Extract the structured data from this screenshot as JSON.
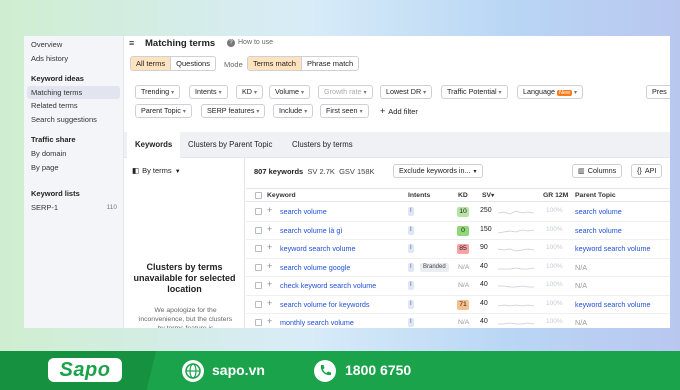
{
  "sidebar": {
    "overview": "Overview",
    "ads_history": "Ads history",
    "keyword_ideas_head": "Keyword ideas",
    "matching_terms": "Matching terms",
    "related_terms": "Related terms",
    "search_suggestions": "Search suggestions",
    "traffic_share_head": "Traffic share",
    "by_domain": "By domain",
    "by_page": "By page",
    "keyword_lists_head": "Keyword lists",
    "serp_list": "SERP-1",
    "serp_count": "110"
  },
  "header": {
    "menu_icon": "≡",
    "title": "Matching terms",
    "how_to_use": "How to use"
  },
  "scope": {
    "all_terms": "All terms",
    "questions": "Questions",
    "mode_label": "Mode",
    "terms_match": "Terms match",
    "phrase_match": "Phrase match"
  },
  "filters": {
    "trending": "Trending",
    "intents": "Intents",
    "kd": "KD",
    "volume": "Volume",
    "growth_rate": "Growth rate",
    "lowest_dr": "Lowest DR",
    "traffic_potential": "Traffic Potential",
    "language": "Language",
    "new_badge": "New",
    "pres": "Pres",
    "parent_topic": "Parent Topic",
    "serp_features": "SERP features",
    "include": "Include",
    "first_seen": "First seen",
    "add_filter": "Add filter"
  },
  "tabs": {
    "keywords": "Keywords",
    "clusters_parent": "Clusters by Parent Topic",
    "clusters_terms": "Clusters by terms"
  },
  "left_panel": {
    "by_terms": "By terms",
    "title": "Clusters by terms unavailable for selected location",
    "text": "We apologize for the inconvenience, but the clusters by terms feature is"
  },
  "summary": {
    "count": "807 keywords",
    "sv": "SV 2.7K",
    "gsv": "GSV 158K",
    "exclude": "Exclude keywords in...",
    "columns": "Columns",
    "api": "API"
  },
  "table": {
    "headers": {
      "keyword": "Keyword",
      "intents": "Intents",
      "kd": "KD",
      "sv": "SV",
      "gr": "GR 12M",
      "parent": "Parent Topic"
    },
    "rows": [
      {
        "keyword": "search volume",
        "intent": "I",
        "branded": "",
        "kd": "10",
        "kd_color": "#b7e4a6",
        "sv": "250",
        "gr": "100%",
        "parent": "search volume"
      },
      {
        "keyword": "search volume là gì",
        "intent": "I",
        "branded": "",
        "kd": "0",
        "kd_color": "#8fd77a",
        "sv": "150",
        "gr": "100%",
        "parent": "search volume"
      },
      {
        "keyword": "keyword search volume",
        "intent": "I",
        "branded": "",
        "kd": "85",
        "kd_color": "#f5a3a3",
        "sv": "90",
        "gr": "100%",
        "parent": "keyword search volume"
      },
      {
        "keyword": "search volume google",
        "intent": "I",
        "branded": "Branded",
        "kd": "N/A",
        "kd_color": "",
        "sv": "40",
        "gr": "100%",
        "parent": "N/A"
      },
      {
        "keyword": "check keyword search volume",
        "intent": "I",
        "branded": "",
        "kd": "N/A",
        "kd_color": "",
        "sv": "40",
        "gr": "100%",
        "parent": "N/A"
      },
      {
        "keyword": "search volume for keywords",
        "intent": "I",
        "branded": "",
        "kd": "71",
        "kd_color": "#f7c08e",
        "sv": "40",
        "gr": "100%",
        "parent": "keyword search volume"
      },
      {
        "keyword": "monthly search volume",
        "intent": "I",
        "branded": "",
        "kd": "N/A",
        "kd_color": "",
        "sv": "40",
        "gr": "100%",
        "parent": "N/A"
      }
    ]
  },
  "footer": {
    "logo": "Sapo",
    "website": "sapo.vn",
    "phone": "1800 6750",
    "brand_color": "#1aa34a"
  }
}
